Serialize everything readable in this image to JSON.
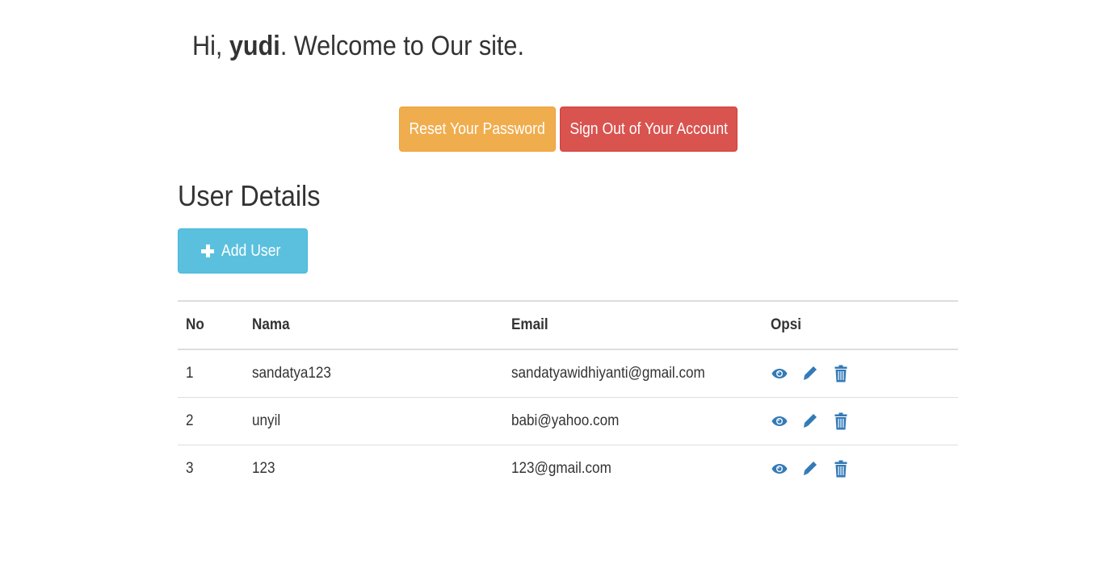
{
  "header": {
    "greeting_prefix": "Hi, ",
    "username": "yudi",
    "greeting_suffix": ". Welcome to Our site."
  },
  "actions": {
    "reset_password_label": "Reset Your Password",
    "sign_out_label": "Sign Out of Your Account"
  },
  "section": {
    "title": "User Details",
    "add_user_label": "Add User"
  },
  "table": {
    "columns": [
      "No",
      "Nama",
      "Email",
      "Opsi"
    ],
    "rows": [
      {
        "no": "1",
        "nama": "sandatya123",
        "email": "sandatyawidhiyanti@gmail.com"
      },
      {
        "no": "2",
        "nama": "unyil",
        "email": "babi@yahoo.com"
      },
      {
        "no": "3",
        "nama": "123",
        "email": "123@gmail.com"
      }
    ],
    "row_action_icons": [
      "eye-icon",
      "pencil-icon",
      "trash-icon"
    ]
  },
  "colors": {
    "warning": "#f0ad4e",
    "danger": "#d9534f",
    "info": "#5bc0de",
    "icon": "#337ab7"
  }
}
